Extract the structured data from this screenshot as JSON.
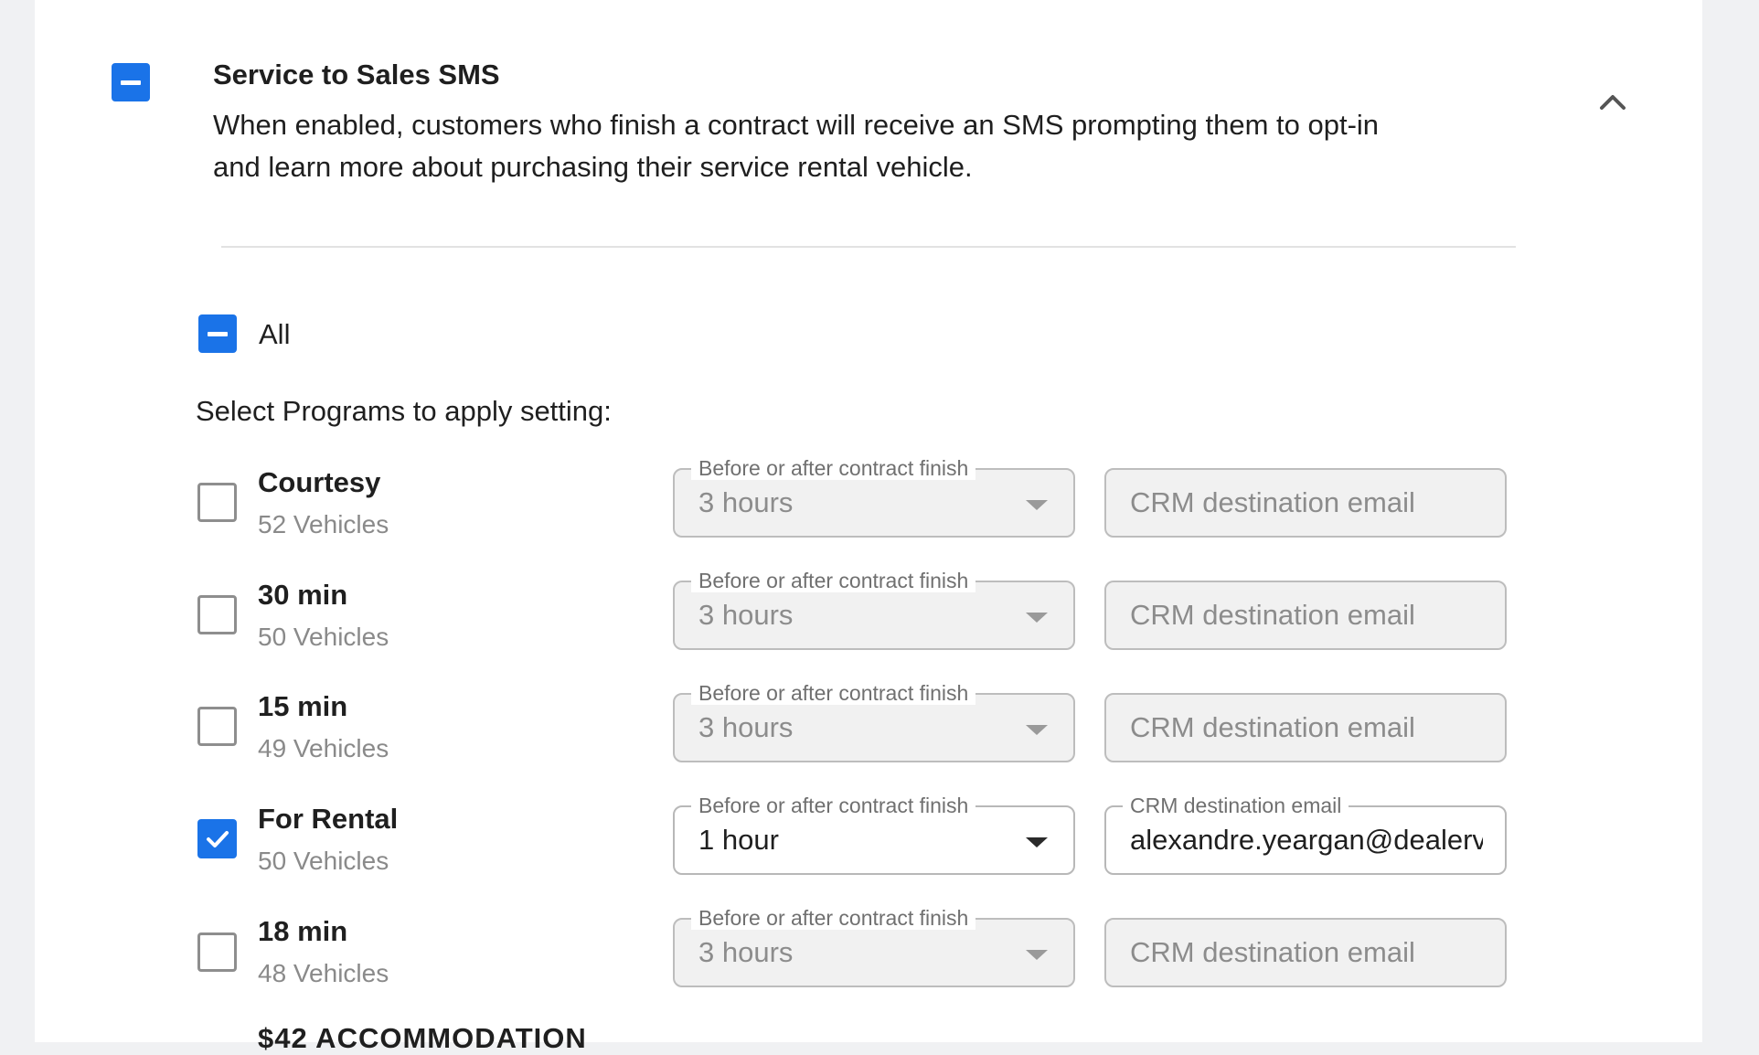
{
  "section": {
    "title": "Service to Sales SMS",
    "description": "When enabled, customers who finish a contract will receive an SMS prompting them to opt-in and learn more about purchasing their service rental vehicle.",
    "collapse_icon": "chevron-up-icon"
  },
  "all_label": "All",
  "select_label": "Select Programs to apply setting:",
  "programs": [
    {
      "name": "Courtesy",
      "count": "52 Vehicles",
      "checked": false,
      "timing_label": "Before or after contract finish",
      "timing_value": "3 hours",
      "email_placeholder": "CRM destination email",
      "email_value": ""
    },
    {
      "name": "30 min",
      "count": "50 Vehicles",
      "checked": false,
      "timing_label": "Before or after contract finish",
      "timing_value": "3 hours",
      "email_placeholder": "CRM destination email",
      "email_value": ""
    },
    {
      "name": "15 min",
      "count": "49 Vehicles",
      "checked": false,
      "timing_label": "Before or after contract finish",
      "timing_value": "3 hours",
      "email_placeholder": "CRM destination email",
      "email_value": ""
    },
    {
      "name": "For Rental",
      "count": "50 Vehicles",
      "checked": true,
      "timing_label": "Before or after contract finish",
      "timing_value": "1 hour",
      "email_label": "CRM destination email",
      "email_value": "alexandre.yeargan@dealerv"
    },
    {
      "name": "18 min",
      "count": "48 Vehicles",
      "checked": false,
      "timing_label": "Before or after contract finish",
      "timing_value": "3 hours",
      "email_placeholder": "CRM destination email",
      "email_value": ""
    }
  ],
  "partial_item": "$42 ACCOMMODATION",
  "colors": {
    "accent": "#1a73e8",
    "checkbox_border": "#8e8e8e",
    "muted_text": "#8a8a8a"
  }
}
